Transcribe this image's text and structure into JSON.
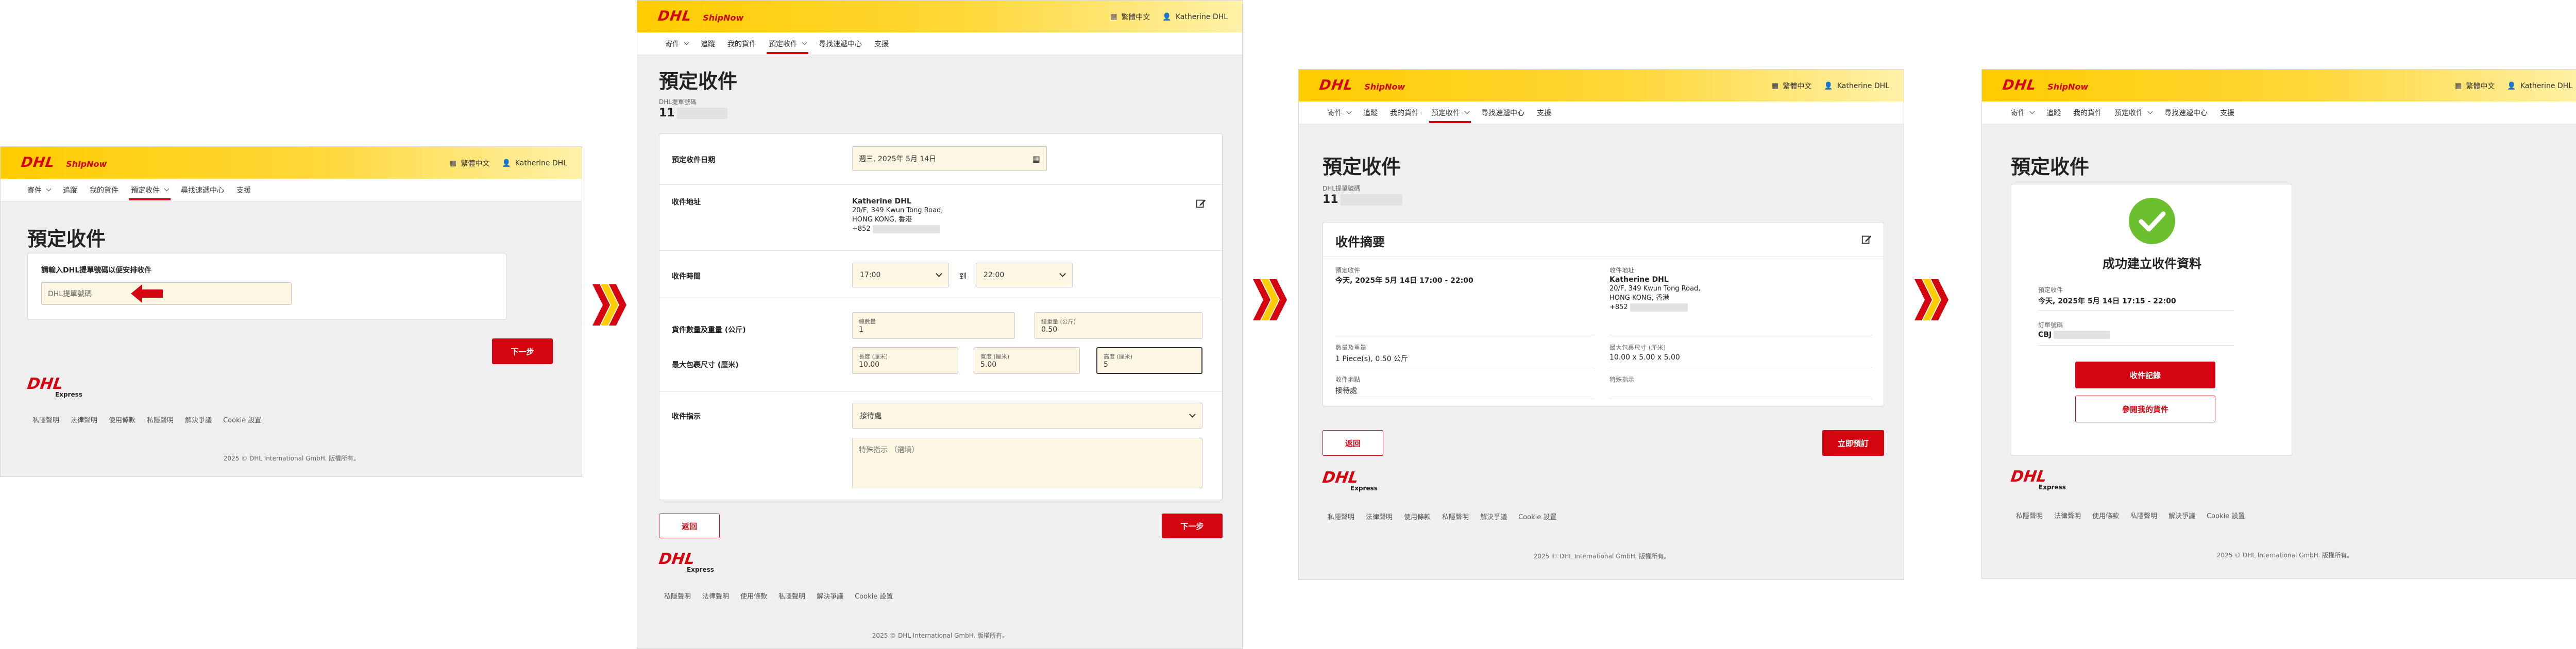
{
  "header": {
    "logo": "DHL",
    "brand": "ShipNow",
    "language": "繁體中文",
    "user": "Katherine DHL"
  },
  "nav": {
    "items": [
      {
        "label": "寄件",
        "dropdown": true
      },
      {
        "label": "追蹤",
        "dropdown": false
      },
      {
        "label": "我的貨件",
        "dropdown": false
      },
      {
        "label": "預定收件",
        "dropdown": true
      },
      {
        "label": "尋找速遞中心",
        "dropdown": false
      },
      {
        "label": "支援",
        "dropdown": false
      }
    ]
  },
  "page_title": "預定收件",
  "step1": {
    "prompt": "請輸入DHL提單號碼以便安排收件",
    "waybill_placeholder": "DHL提單號碼",
    "next": "下一步"
  },
  "step2": {
    "waybill_label": "DHL提單號碼",
    "waybill_value": "11",
    "date_label": "預定收件日期",
    "date_value": "週三, 2025年 5月 14日",
    "address_label": "收件地址",
    "address_name": "Katherine DHL",
    "address_line1": "20/F, 349 Kwun Tong Road,",
    "address_line2": "HONG KONG, 香港",
    "address_phone": "+852",
    "time_label": "收件時間",
    "time_from": "17:00",
    "time_to_word": "到",
    "time_to": "22:00",
    "qty_label": "貨件數量及重量 (公斤)",
    "pieces_label": "總數量",
    "pieces_value": "1",
    "weight_label": "總重量 (公斤)",
    "weight_value": "0.50",
    "dims_label": "最大包裹尺寸 (厘米)",
    "length_label": "長度 (厘米)",
    "length_value": "10.00",
    "width_label": "寬度 (厘米)",
    "width_value": "5.00",
    "height_label": "高度 (厘米)",
    "height_value": "5",
    "instr_label": "收件指示",
    "instr_value": "接待處",
    "special_placeholder": "特殊指示 （選填）",
    "back": "返回",
    "next": "下一步"
  },
  "step3": {
    "waybill_label": "DHL提單號碼",
    "waybill_value": "11",
    "summary_title": "收件摘要",
    "pickup_label": "預定收件",
    "pickup_value": "今天, 2025年 5月 14日 17:00 - 22:00",
    "address_label": "收件地址",
    "address_name": "Katherine DHL",
    "address_line1": "20/F, 349 Kwun Tong Road,",
    "address_line2": "HONG KONG, 香港",
    "address_phone": "+852",
    "qty_label": "數量及重量",
    "qty_value": "1 Piece(s), 0.50 公斤",
    "dims_label": "最大包裹尺寸 (厘米)",
    "dims_value": "10.00 x 5.00 x 5.00",
    "location_label": "收件地點",
    "location_value": "接待處",
    "special_label": "特殊指示",
    "special_value": "",
    "back": "返回",
    "confirm": "立即預訂"
  },
  "step4": {
    "success_title": "成功建立收件資料",
    "pickup_label": "預定收件",
    "pickup_value": "今天, 2025年 5月 14日 17:15 - 22:00",
    "ref_label": "訂單號碼",
    "ref_value": "CBJ",
    "records_btn": "收件記錄",
    "view_btn": "參閱我的貨件"
  },
  "footer": {
    "logo": "DHL",
    "express": "Express",
    "links": [
      "私隱聲明",
      "法律聲明",
      "使用條款",
      "私隱聲明",
      "解決爭議",
      "Cookie 設置"
    ],
    "copyright": "2025 © DHL International GmbH. 版權所有。"
  },
  "colors": {
    "brand_yellow": "#ffcc00",
    "brand_red": "#d40511",
    "success_green": "#6cbf2e"
  }
}
